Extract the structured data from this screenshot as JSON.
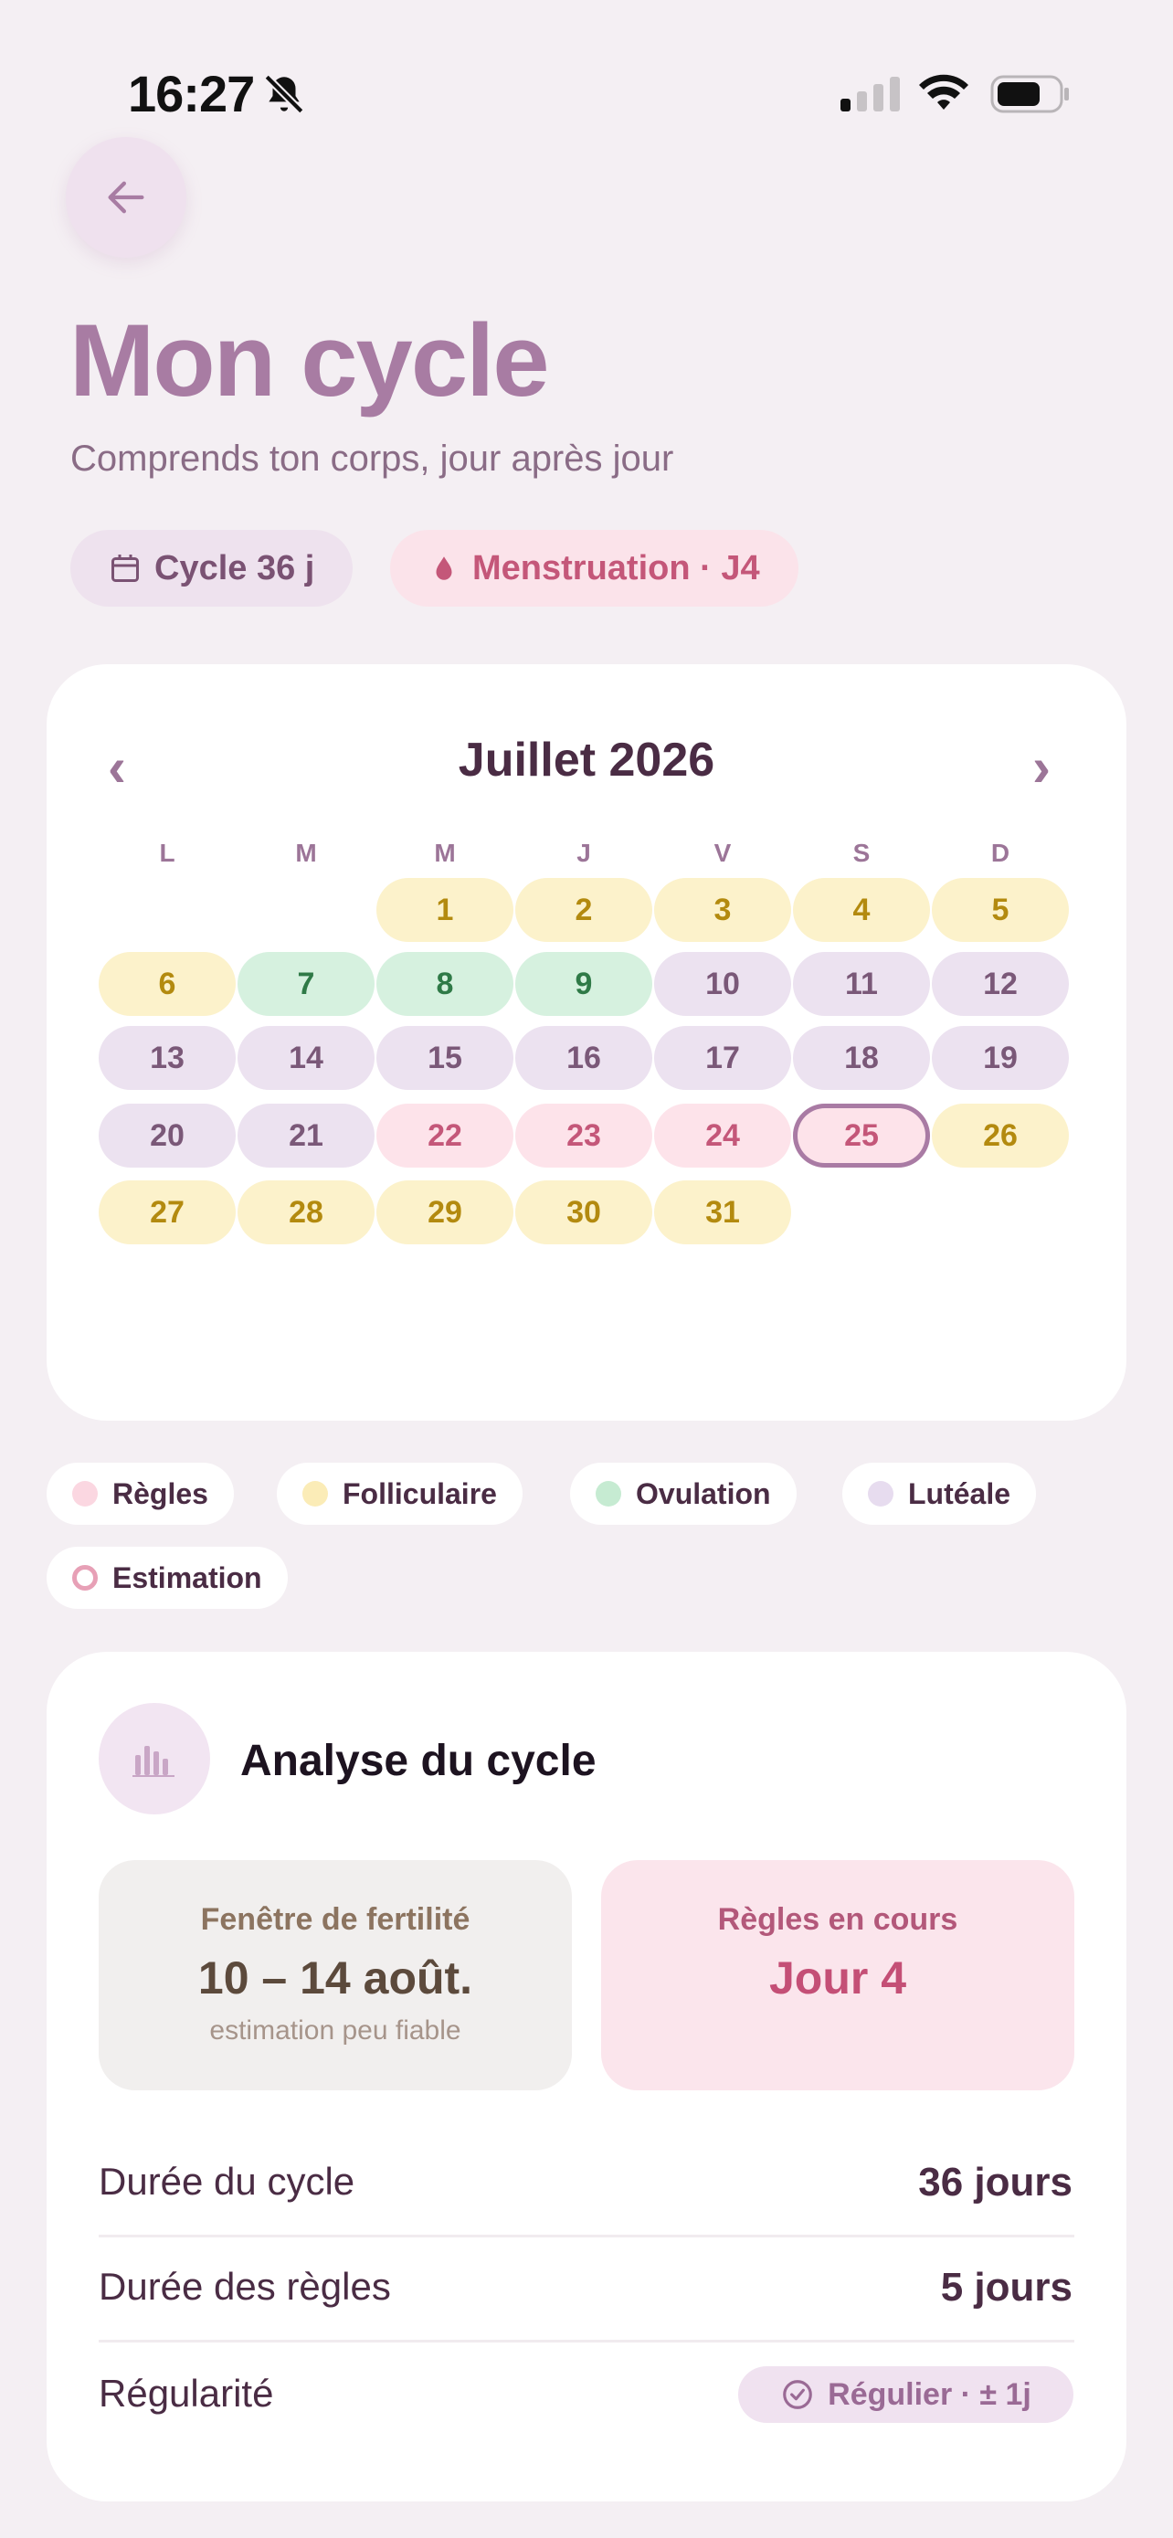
{
  "status_bar": {
    "time": "16:27"
  },
  "header": {
    "title": "Mon cycle",
    "subtitle": "Comprends ton corps, jour après jour",
    "chip_cycle": "Cycle 36 j",
    "chip_phase": "Menstruation · J4"
  },
  "calendar": {
    "month": "Juillet 2026",
    "prev": "‹",
    "next": "›",
    "weekdays": [
      "L",
      "M",
      "M",
      "J",
      "V",
      "S",
      "D"
    ],
    "first_weekday_index": 2,
    "today": 25,
    "days": [
      {
        "n": "1",
        "phase": "fol"
      },
      {
        "n": "2",
        "phase": "fol"
      },
      {
        "n": "3",
        "phase": "fol"
      },
      {
        "n": "4",
        "phase": "fol"
      },
      {
        "n": "5",
        "phase": "fol"
      },
      {
        "n": "6",
        "phase": "fol"
      },
      {
        "n": "7",
        "phase": "ovu"
      },
      {
        "n": "8",
        "phase": "ovu"
      },
      {
        "n": "9",
        "phase": "ovu"
      },
      {
        "n": "10",
        "phase": "lut"
      },
      {
        "n": "11",
        "phase": "lut"
      },
      {
        "n": "12",
        "phase": "lut"
      },
      {
        "n": "13",
        "phase": "lut"
      },
      {
        "n": "14",
        "phase": "lut"
      },
      {
        "n": "15",
        "phase": "lut"
      },
      {
        "n": "16",
        "phase": "lut"
      },
      {
        "n": "17",
        "phase": "lut"
      },
      {
        "n": "18",
        "phase": "lut"
      },
      {
        "n": "19",
        "phase": "lut"
      },
      {
        "n": "20",
        "phase": "lut"
      },
      {
        "n": "21",
        "phase": "lut"
      },
      {
        "n": "22",
        "phase": "reg"
      },
      {
        "n": "23",
        "phase": "reg"
      },
      {
        "n": "24",
        "phase": "reg"
      },
      {
        "n": "25",
        "phase": "today"
      },
      {
        "n": "26",
        "phase": "fol"
      },
      {
        "n": "27",
        "phase": "fol"
      },
      {
        "n": "28",
        "phase": "fol"
      },
      {
        "n": "29",
        "phase": "fol"
      },
      {
        "n": "30",
        "phase": "fol"
      },
      {
        "n": "31",
        "phase": "fol"
      }
    ]
  },
  "legend": {
    "regles": "Règles",
    "folliculaire": "Folliculaire",
    "ovulation": "Ovulation",
    "luteale": "Lutéale",
    "estimation": "Estimation"
  },
  "colors": {
    "regles": "#fbd7e1",
    "folliculaire": "#fbecb7",
    "ovulation": "#c6ebd2",
    "luteale": "#e7dcef",
    "accent": "#a87ca3"
  },
  "analysis": {
    "title": "Analyse du cycle",
    "fertility_label": "Fenêtre de fertilité",
    "fertility_value": "10 – 14 août.",
    "fertility_note": "estimation peu fiable",
    "period_label": "Règles en cours",
    "period_value": "Jour 4",
    "rows": [
      {
        "label": "Durée du cycle",
        "value": "36 jours"
      },
      {
        "label": "Durée des règles",
        "value": "5 jours"
      },
      {
        "label": "Régularité",
        "value": "Régulier · ± 1j"
      }
    ]
  }
}
